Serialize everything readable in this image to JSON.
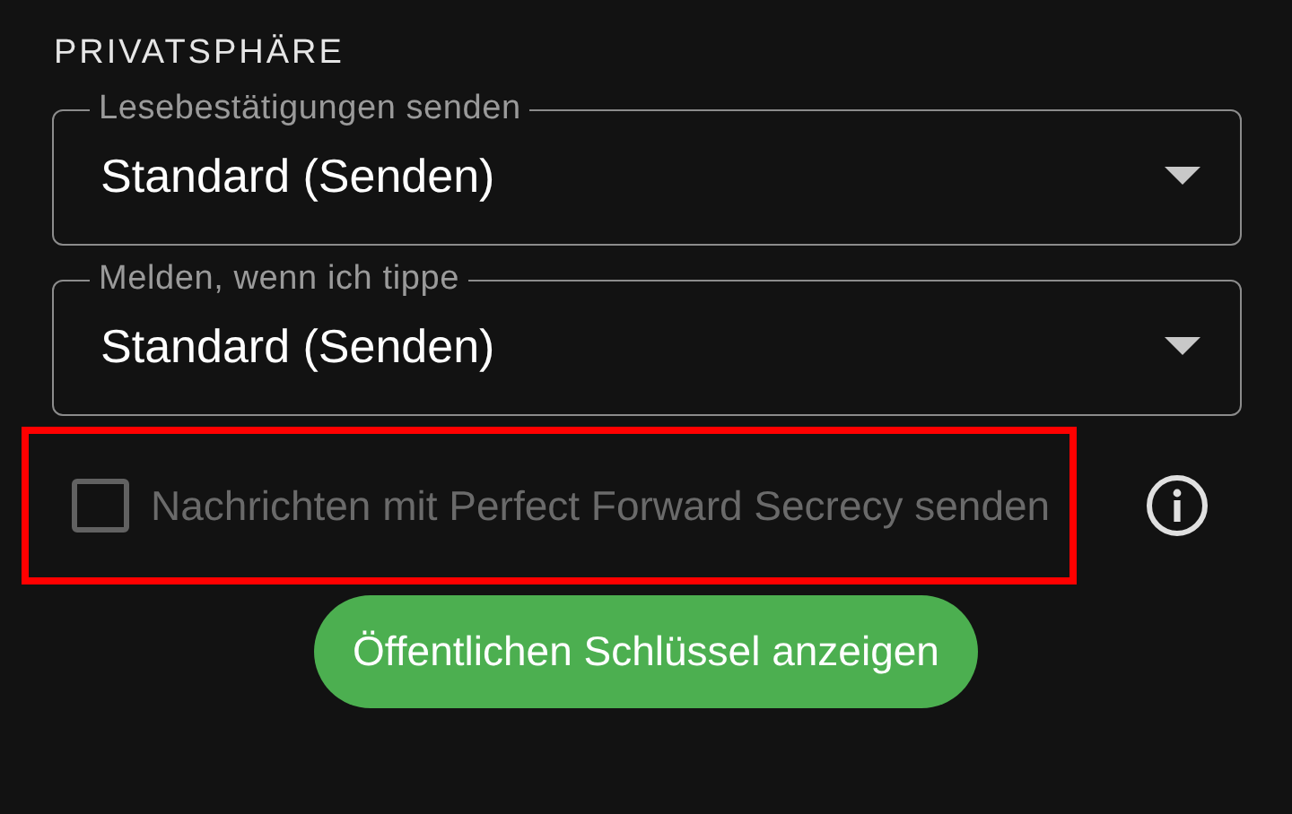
{
  "section": {
    "title": "PRIVATSPHÄRE"
  },
  "dropdowns": [
    {
      "label": "Lesebestätigungen senden",
      "value": "Standard (Senden)"
    },
    {
      "label": "Melden, wenn ich tippe",
      "value": "Standard (Senden)"
    }
  ],
  "checkbox": {
    "label": "Nachrichten mit Perfect Forward Secrecy senden",
    "checked": false,
    "disabled": true,
    "highlighted": true
  },
  "button": {
    "label": "Öffentlichen Schlüssel anzeigen"
  }
}
